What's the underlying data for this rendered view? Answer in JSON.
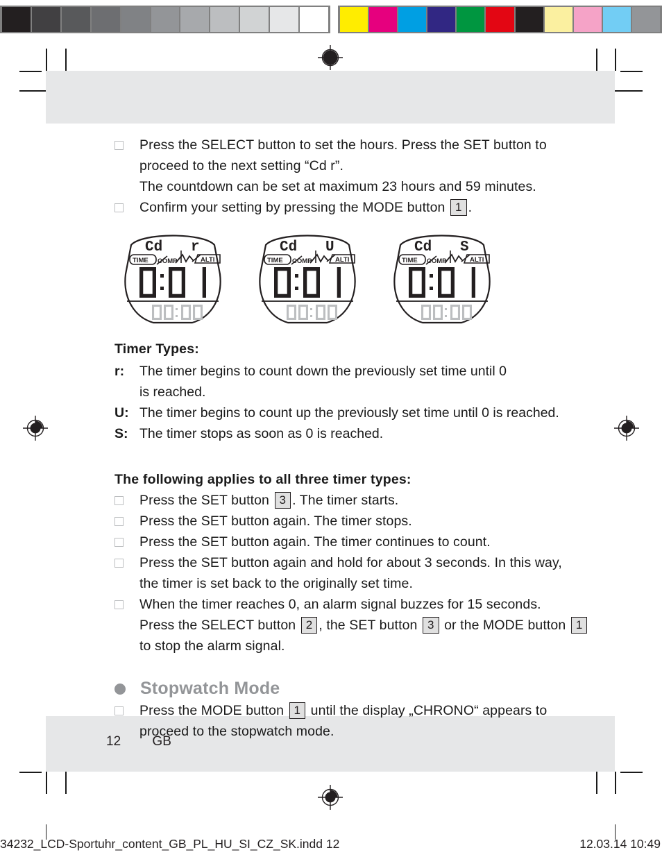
{
  "calibration": {
    "grayscale_label": "grayscale-step-wedge",
    "grayscale": [
      "#231f20",
      "#414042",
      "#58595b",
      "#6d6e71",
      "#808285",
      "#939598",
      "#a7a9ac",
      "#bcbec0",
      "#d1d3d4",
      "#e6e7e8",
      "#ffffff"
    ],
    "colors_label": "process-color-patches",
    "colors": [
      "#ffed00",
      "#e6007e",
      "#009fe3",
      "#312783",
      "#009640",
      "#e30613",
      "#231f20",
      "#fbf0a0",
      "#f5a3c7",
      "#72cdf4",
      "#939598"
    ]
  },
  "page": {
    "bullet_glyph": "square-outline",
    "blocks": [
      {
        "id": "b1",
        "bullet": true,
        "lines": [
          "Press the SELECT button to set the hours. Press the SET button to",
          "proceed to the next setting “Cd r”.",
          "The countdown can be set at maximum 23 hours and 59 minutes."
        ]
      },
      {
        "id": "b2",
        "bullet": true,
        "pre": "Confirm your setting by pressing the MODE button ",
        "chip": "1",
        "post": "."
      }
    ],
    "timer_types": {
      "heading": "Timer Types:",
      "items": [
        {
          "key": "r:",
          "text": "The timer begins to count down the previously set time until 0 is reached."
        },
        {
          "key": "U:",
          "text": "The timer begins to count up the previously set time until 0 is reached."
        },
        {
          "key": "S:",
          "text": "The timer stops as soon as 0 is reached."
        }
      ]
    },
    "all_types": {
      "heading": "The following applies to all three timer types:",
      "items": [
        {
          "pre": "Press the SET button ",
          "chip": "3",
          "post": ". The timer starts."
        },
        {
          "pre": "Press the SET button again. The timer stops.",
          "chip": "",
          "post": ""
        },
        {
          "pre": "Press the SET button again. The timer continues to count.",
          "chip": "",
          "post": ""
        },
        {
          "pre": "Press the SET button again and hold for about 3 seconds. In this way, the timer is set back to the originally set time.",
          "chip": "",
          "post": ""
        }
      ],
      "alarm": {
        "line1": "When the timer reaches 0, an alarm signal buzzes for 15 seconds.",
        "l2a": "Press the SELECT button ",
        "chip1": "2",
        "l2b": ", the SET button ",
        "chip2": "3",
        "l2c": " or the MODE button ",
        "chip3": "1",
        "line3": "to stop the alarm signal."
      }
    },
    "stopwatch": {
      "title": "Stopwatch Mode",
      "pre": "Press the MODE button ",
      "chip": "1",
      "post": " until the display „CHRONO“ appears to proceed to the stopwatch mode."
    },
    "folio": {
      "number": "12",
      "language": "GB"
    },
    "slug": {
      "file": "34232_LCD-Sportuhr_content_GB_PL_HU_SI_CZ_SK.indd   12",
      "stamp": "12.03.14   10:49"
    }
  },
  "lcd_figures": [
    {
      "id": "fig-cd-r",
      "top_left": "Cd",
      "top_right": "r",
      "main": "0:01",
      "secondary": "00:00",
      "labels": [
        "TIME",
        "COMP",
        "ALTI"
      ]
    },
    {
      "id": "fig-cd-u",
      "top_left": "Cd",
      "top_right": "U",
      "main": "0:01",
      "secondary": "00:00",
      "labels": [
        "TIME",
        "COMP",
        "ALTI"
      ]
    },
    {
      "id": "fig-cd-s",
      "top_left": "Cd",
      "top_right": "S",
      "main": "0:01",
      "secondary": "00:00",
      "labels": [
        "TIME",
        "COMP",
        "ALTI"
      ]
    }
  ]
}
